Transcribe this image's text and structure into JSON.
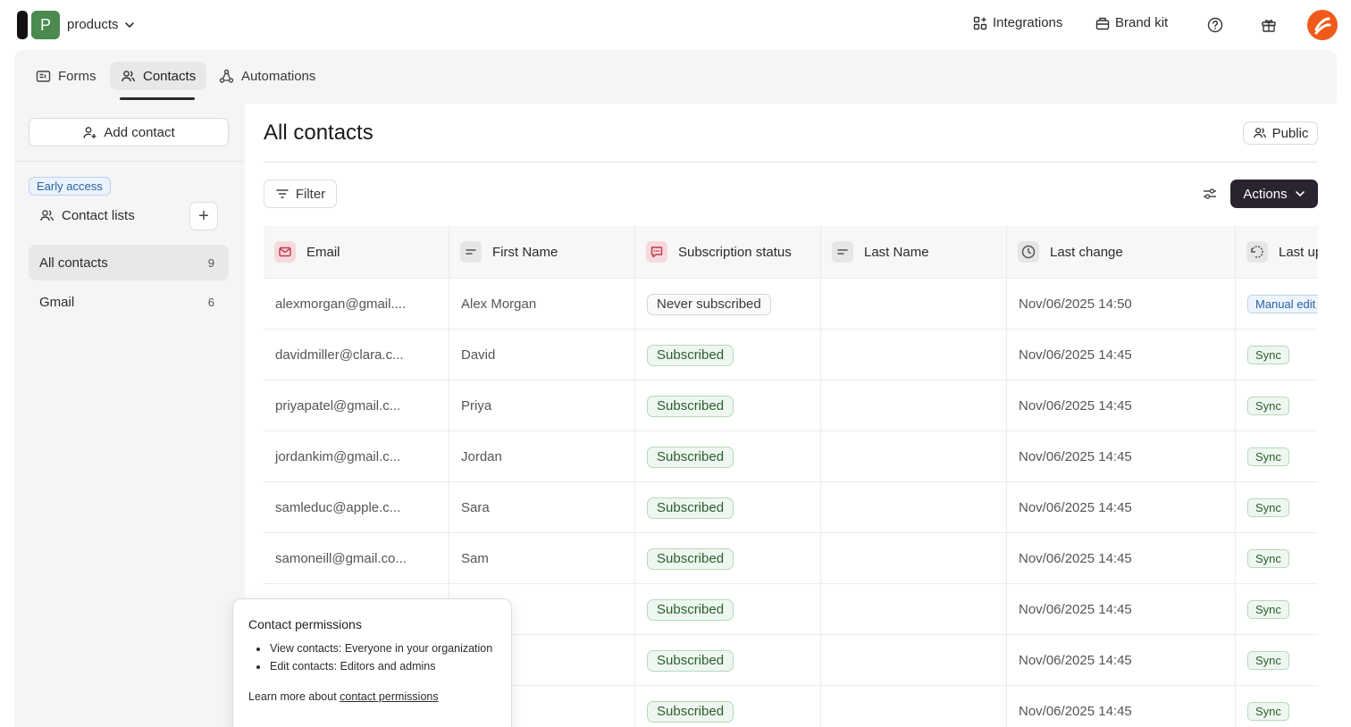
{
  "workspace": {
    "initial": "P",
    "name": "products"
  },
  "topnav": {
    "integrations": "Integrations",
    "brand_kit": "Brand kit"
  },
  "tabs": [
    {
      "label": "Forms"
    },
    {
      "label": "Contacts"
    },
    {
      "label": "Automations"
    }
  ],
  "sidebar": {
    "add_contact": "Add contact",
    "early_access": "Early access",
    "contact_lists": "Contact lists",
    "add_list": "+",
    "lists": [
      {
        "label": "All contacts",
        "count": "9"
      },
      {
        "label": "Gmail",
        "count": "6"
      }
    ]
  },
  "main": {
    "title": "All contacts",
    "visibility": "Public",
    "filter": "Filter",
    "actions": "Actions"
  },
  "table": {
    "columns": [
      {
        "label": "Email",
        "icon": "mail-icon",
        "color": "#f6d9dd"
      },
      {
        "label": "First Name",
        "icon": "text-lines-icon",
        "color": "#e6e6e6"
      },
      {
        "label": "Subscription status",
        "icon": "message-icon",
        "color": "#f6d9dd"
      },
      {
        "label": "Last Name",
        "icon": "text-lines-icon",
        "color": "#e6e6e6"
      },
      {
        "label": "Last change",
        "icon": "clock-icon",
        "color": "#e6e6e6"
      },
      {
        "label": "Last up",
        "icon": "update-icon",
        "color": "#e6e6e6"
      }
    ],
    "rows": [
      {
        "email": "alexmorgan@gmail....",
        "first": "Alex Morgan",
        "status": "Never subscribed",
        "last": "",
        "changed": "Nov/06/2025 14:50",
        "source": "Manual edit"
      },
      {
        "email": "davidmiller@clara.c...",
        "first": "David",
        "status": "Subscribed",
        "last": "",
        "changed": "Nov/06/2025 14:45",
        "source": "Sync"
      },
      {
        "email": "priyapatel@gmail.c...",
        "first": "Priya",
        "status": "Subscribed",
        "last": "",
        "changed": "Nov/06/2025 14:45",
        "source": "Sync"
      },
      {
        "email": "jordankim@gmail.c...",
        "first": "Jordan",
        "status": "Subscribed",
        "last": "",
        "changed": "Nov/06/2025 14:45",
        "source": "Sync"
      },
      {
        "email": "samleduc@apple.c...",
        "first": "Sara",
        "status": "Subscribed",
        "last": "",
        "changed": "Nov/06/2025 14:45",
        "source": "Sync"
      },
      {
        "email": "samoneill@gmail.co...",
        "first": "Sam",
        "status": "Subscribed",
        "last": "",
        "changed": "Nov/06/2025 14:45",
        "source": "Sync"
      },
      {
        "email": "",
        "first": "",
        "status": "Subscribed",
        "last": "",
        "changed": "Nov/06/2025 14:45",
        "source": "Sync"
      },
      {
        "email": "",
        "first": "",
        "status": "Subscribed",
        "last": "",
        "changed": "Nov/06/2025 14:45",
        "source": "Sync"
      },
      {
        "email": "",
        "first": "",
        "status": "Subscribed",
        "last": "",
        "changed": "Nov/06/2025 14:45",
        "source": "Sync"
      }
    ]
  },
  "popover": {
    "title": "Contact permissions",
    "items": [
      "View contacts: Everyone in your organization",
      "Edit contacts: Editors and admins"
    ],
    "learn_prefix": "Learn more about ",
    "learn_link": "contact permissions"
  },
  "colors": {
    "primary_button": "#2b2430",
    "subscribed": "#2b5e30",
    "info": "#2862a8",
    "avatar": "#f05a1a",
    "workspace": "#4a8a4e"
  }
}
